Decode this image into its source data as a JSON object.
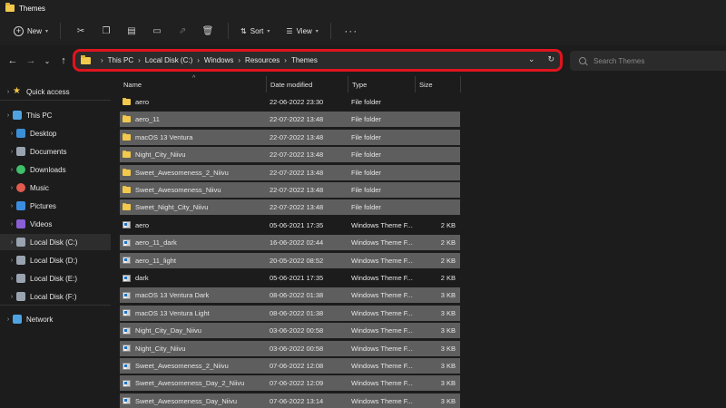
{
  "window": {
    "title": "Themes"
  },
  "toolbar": {
    "new_label": "New",
    "sort_label": "Sort",
    "view_label": "View"
  },
  "address": {
    "crumbs": [
      "This PC",
      "Local Disk (C:)",
      "Windows",
      "Resources",
      "Themes"
    ]
  },
  "search": {
    "placeholder": "Search Themes"
  },
  "sidebar": {
    "items": [
      {
        "label": "Quick access",
        "icon": "star-icon",
        "color": "#f4c542"
      },
      {
        "label": "This PC",
        "icon": "computer-icon",
        "color": "#4fa3e0"
      },
      {
        "label": "Desktop",
        "icon": "desktop-icon",
        "color": "#3b8fd6"
      },
      {
        "label": "Documents",
        "icon": "documents-icon",
        "color": "#9aa4b0"
      },
      {
        "label": "Downloads",
        "icon": "downloads-icon",
        "color": "#3fbf6a"
      },
      {
        "label": "Music",
        "icon": "music-icon",
        "color": "#e35a4f"
      },
      {
        "label": "Pictures",
        "icon": "pictures-icon",
        "color": "#3a8de0"
      },
      {
        "label": "Videos",
        "icon": "videos-icon",
        "color": "#8a5fd6"
      },
      {
        "label": "Local Disk (C:)",
        "icon": "drive-icon",
        "color": "#9aa4b0"
      },
      {
        "label": "Local Disk (D:)",
        "icon": "drive-icon",
        "color": "#9aa4b0"
      },
      {
        "label": "Local Disk (E:)",
        "icon": "drive-icon",
        "color": "#9aa4b0"
      },
      {
        "label": "Local Disk (F:)",
        "icon": "drive-icon",
        "color": "#9aa4b0"
      },
      {
        "label": "Network",
        "icon": "network-icon",
        "color": "#4fa3e0"
      }
    ]
  },
  "columns": {
    "name": "Name",
    "date": "Date modified",
    "type": "Type",
    "size": "Size"
  },
  "files": [
    {
      "name": "aero",
      "date": "22-06-2022 23:30",
      "type": "File folder",
      "size": "",
      "kind": "folder",
      "selected": false
    },
    {
      "name": "aero_11",
      "date": "22-07-2022 13:48",
      "type": "File folder",
      "size": "",
      "kind": "folder",
      "selected": true
    },
    {
      "name": "macOS 13 Ventura",
      "date": "22-07-2022 13:48",
      "type": "File folder",
      "size": "",
      "kind": "folder",
      "selected": true
    },
    {
      "name": "Night_City_Niivu",
      "date": "22-07-2022 13:48",
      "type": "File folder",
      "size": "",
      "kind": "folder",
      "selected": true
    },
    {
      "name": "Sweet_Awesomeness_2_Niivu",
      "date": "22-07-2022 13:48",
      "type": "File folder",
      "size": "",
      "kind": "folder",
      "selected": true
    },
    {
      "name": "Sweet_Awesomeness_Niivu",
      "date": "22-07-2022 13:48",
      "type": "File folder",
      "size": "",
      "kind": "folder",
      "selected": true
    },
    {
      "name": "Sweet_Night_City_Niivu",
      "date": "22-07-2022 13:48",
      "type": "File folder",
      "size": "",
      "kind": "folder",
      "selected": true
    },
    {
      "name": "aero",
      "date": "05-06-2021 17:35",
      "type": "Windows Theme F...",
      "size": "2 KB",
      "kind": "theme",
      "selected": false
    },
    {
      "name": "aero_11_dark",
      "date": "16-06-2022 02:44",
      "type": "Windows Theme F...",
      "size": "2 KB",
      "kind": "theme",
      "selected": true
    },
    {
      "name": "aero_11_light",
      "date": "20-05-2022 08:52",
      "type": "Windows Theme F...",
      "size": "2 KB",
      "kind": "theme",
      "selected": true
    },
    {
      "name": "dark",
      "date": "05-06-2021 17:35",
      "type": "Windows Theme F...",
      "size": "2 KB",
      "kind": "theme",
      "selected": false
    },
    {
      "name": "macOS 13 Ventura Dark",
      "date": "08-06-2022 01:38",
      "type": "Windows Theme F...",
      "size": "3 KB",
      "kind": "theme",
      "selected": true
    },
    {
      "name": "macOS 13 Ventura Light",
      "date": "08-06-2022 01:38",
      "type": "Windows Theme F...",
      "size": "3 KB",
      "kind": "theme",
      "selected": true
    },
    {
      "name": "Night_City_Day_Niivu",
      "date": "03-06-2022 00:58",
      "type": "Windows Theme F...",
      "size": "3 KB",
      "kind": "theme",
      "selected": true
    },
    {
      "name": "Night_City_Niivu",
      "date": "03-06-2022 00:58",
      "type": "Windows Theme F...",
      "size": "3 KB",
      "kind": "theme",
      "selected": true
    },
    {
      "name": "Sweet_Awesomeness_2_Niivu",
      "date": "07-06-2022 12:08",
      "type": "Windows Theme F...",
      "size": "3 KB",
      "kind": "theme",
      "selected": true
    },
    {
      "name": "Sweet_Awesomeness_Day_2_Niivu",
      "date": "07-06-2022 12:09",
      "type": "Windows Theme F...",
      "size": "3 KB",
      "kind": "theme",
      "selected": true
    },
    {
      "name": "Sweet_Awesomeness_Day_Niivu",
      "date": "07-06-2022 13:14",
      "type": "Windows Theme F...",
      "size": "3 KB",
      "kind": "theme",
      "selected": true
    }
  ],
  "colors": {
    "highlight": "#e0141e",
    "selected_row": "#5e5e5e",
    "folder": "#f2c94c"
  }
}
